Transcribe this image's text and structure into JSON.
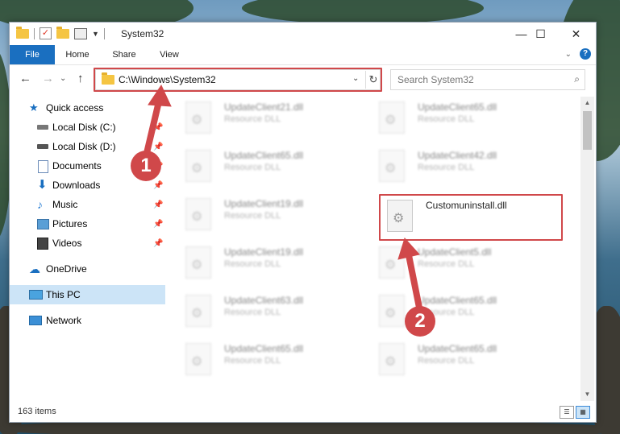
{
  "window": {
    "title": "System32",
    "controls": {
      "minimize": "—",
      "maximize": "☐",
      "close": "✕"
    }
  },
  "ribbon": {
    "tabs": [
      "File",
      "Home",
      "Share",
      "View"
    ],
    "help_label": "?"
  },
  "address_bar": {
    "path": "C:\\Windows\\System32",
    "refresh_icon": "↻"
  },
  "search": {
    "placeholder": "Search System32"
  },
  "sidebar": {
    "quick_access": "Quick access",
    "items": [
      {
        "label": "Local Disk (C:)",
        "icon": "drive-icon",
        "pinned": true
      },
      {
        "label": "Local Disk (D:)",
        "icon": "drive-icon",
        "pinned": true
      },
      {
        "label": "Documents",
        "icon": "documents-icon",
        "pinned": true
      },
      {
        "label": "Downloads",
        "icon": "downloads-icon",
        "pinned": true
      },
      {
        "label": "Music",
        "icon": "music-icon",
        "pinned": true
      },
      {
        "label": "Pictures",
        "icon": "pictures-icon",
        "pinned": true
      },
      {
        "label": "Videos",
        "icon": "videos-icon",
        "pinned": true
      }
    ],
    "onedrive": "OneDrive",
    "this_pc": "This PC",
    "network": "Network"
  },
  "files": [
    {
      "name": "UpdateClient21.dll",
      "type": "Resource DLL",
      "blurred": true
    },
    {
      "name": "UpdateClient65.dll",
      "type": "Resource DLL",
      "blurred": true
    },
    {
      "name": "UpdateClient65.dll",
      "type": "Resource DLL",
      "blurred": true
    },
    {
      "name": "UpdateClient42.dll",
      "type": "Resource DLL",
      "blurred": true
    },
    {
      "name": "UpdateClient19.dll",
      "type": "Resource DLL",
      "blurred": true
    },
    {
      "name": "Customuninstall.dll",
      "type": "",
      "blurred": false,
      "highlighted": true
    },
    {
      "name": "UpdateClient19.dll",
      "type": "Resource DLL",
      "blurred": true
    },
    {
      "name": "UpdateClient5.dll",
      "type": "Resource DLL",
      "blurred": true
    },
    {
      "name": "UpdateClient63.dll",
      "type": "Resource DLL",
      "blurred": true
    },
    {
      "name": "UpdateClient65.dll",
      "type": "Resource DLL",
      "blurred": true
    },
    {
      "name": "UpdateClient65.dll",
      "type": "Resource DLL",
      "blurred": true
    },
    {
      "name": "UpdateClient65.dll",
      "type": "Resource DLL",
      "blurred": true
    }
  ],
  "status": {
    "item_count": "163 items"
  },
  "annotations": {
    "step1": "1",
    "step2": "2"
  },
  "colors": {
    "accent": "#1a6fc0",
    "annotation_red": "#d0484a",
    "selection": "#cce4f7"
  }
}
